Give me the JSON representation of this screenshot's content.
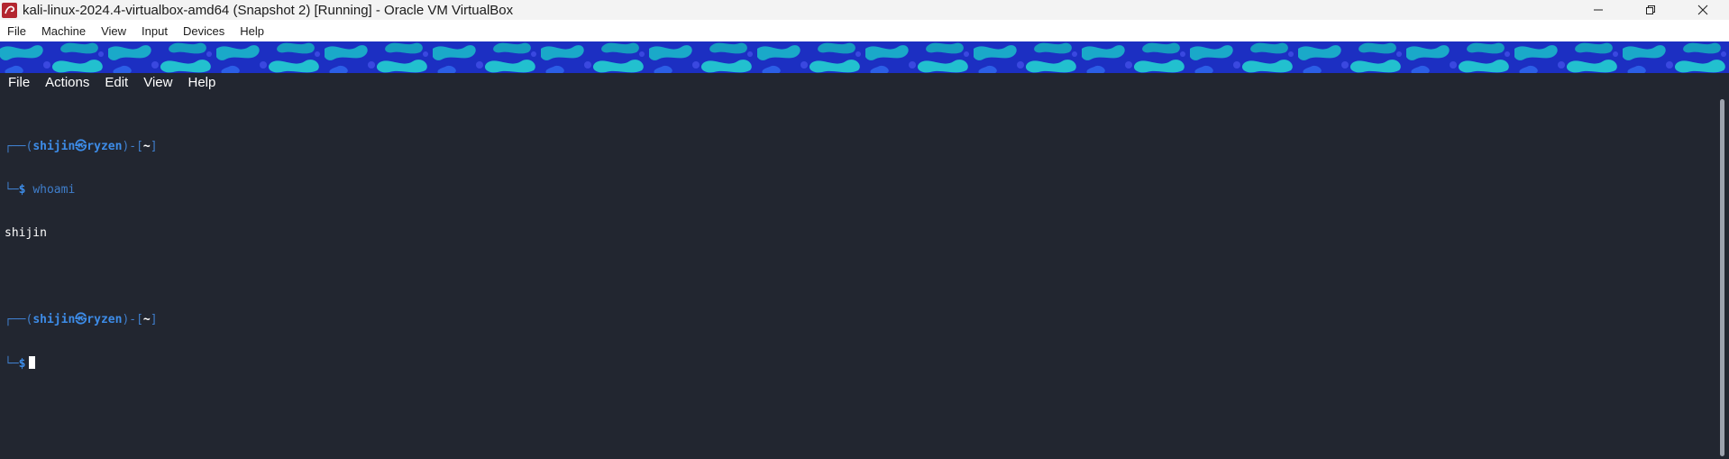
{
  "titlebar": {
    "title": "kali-linux-2024.4-virtualbox-amd64 (Snapshot 2) [Running] - Oracle VM VirtualBox",
    "icon": "virtualbox-icon",
    "controls": [
      "minimize-icon",
      "restore-icon",
      "close-icon"
    ]
  },
  "host_menu": {
    "items": [
      "File",
      "Machine",
      "View",
      "Input",
      "Devices",
      "Help"
    ]
  },
  "terminal": {
    "menu": [
      "File",
      "Actions",
      "Edit",
      "View",
      "Help"
    ],
    "prompt": {
      "frame_top": "┌──(",
      "user": "shijin",
      "separator": "㉿",
      "host": "ryzen",
      "close": ")-[",
      "dir": "~",
      "end": "]",
      "frame_bottom": "└─",
      "dollar": "$"
    },
    "command": "whoami",
    "output": "shijin"
  },
  "colors": {
    "terminal_bg": "#222630",
    "prompt_blue": "#3d8ce8",
    "wallpaper_blue": "#1e34c6",
    "wallpaper_cyan": "#19b4c6"
  }
}
